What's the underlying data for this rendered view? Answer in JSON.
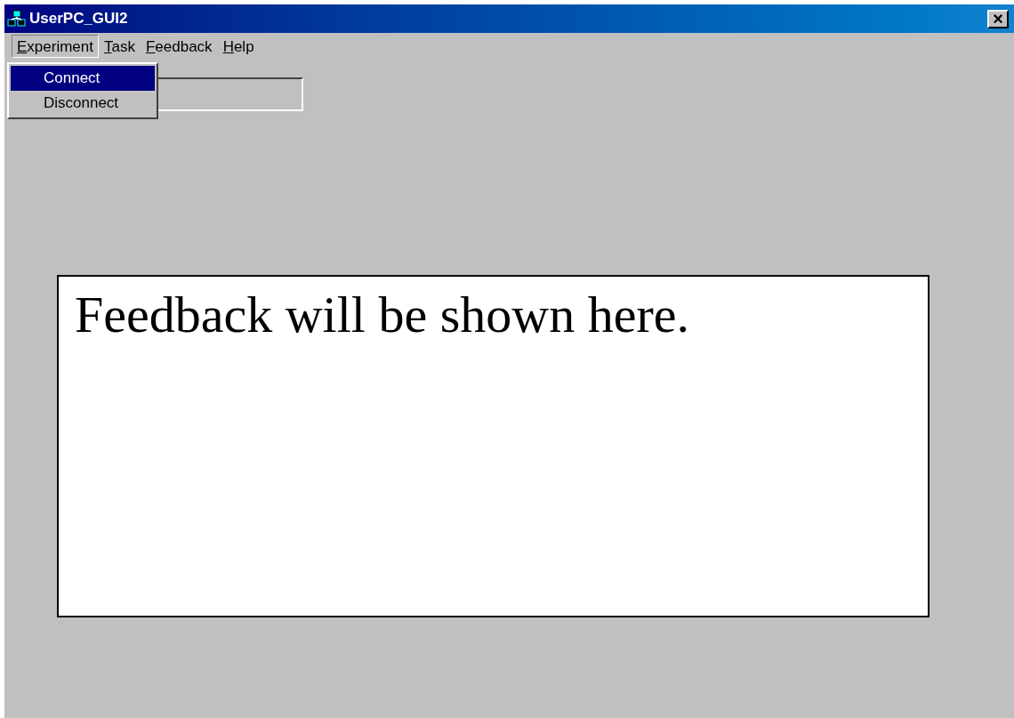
{
  "window": {
    "title": "UserPC_GUI2",
    "close_glyph": "×"
  },
  "menu": [
    {
      "label": "Experiment",
      "selected": true
    },
    {
      "label": "Task",
      "selected": false
    },
    {
      "label": "Feedback",
      "selected": false
    },
    {
      "label": "Help",
      "selected": false
    }
  ],
  "dropdown": [
    {
      "label": "Connect",
      "selected": true
    },
    {
      "label": "Disconnect",
      "selected": false
    }
  ],
  "feedback_panel": {
    "text": "Feedback will be shown here."
  }
}
